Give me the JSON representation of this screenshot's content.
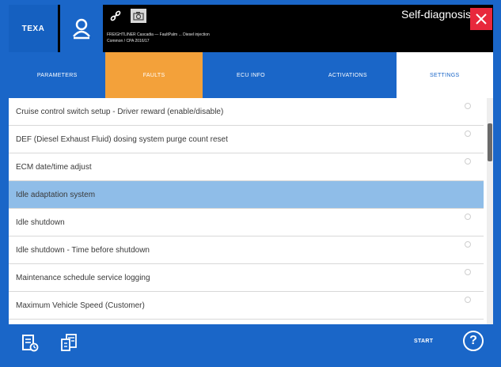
{
  "header": {
    "logo_text": "TEXA",
    "vehicle_line1": "FREIGHTLINER Cascadia — FaultPalm ... Diesel injection",
    "vehicle_line2": "Common / CPA 2016/17",
    "title": "Self-diagnosis",
    "close_icon": "close-icon",
    "brand_color": "#1a66c8",
    "close_color": "#e8283c"
  },
  "tabs": [
    {
      "label": "PARAMETERS"
    },
    {
      "label": "FAULTS"
    },
    {
      "label": "ECU INFO"
    },
    {
      "label": "ACTIVATIONS"
    },
    {
      "label": "SETTINGS"
    }
  ],
  "active_tab_color": "#f3a13a",
  "list": {
    "items": [
      {
        "label": "Cruise control switch setup - Driver reward (enable/disable)"
      },
      {
        "label": "DEF (Diesel Exhaust Fluid) dosing system purge count reset"
      },
      {
        "label": "ECM date/time adjust"
      },
      {
        "label": "Idle adaptation system",
        "selected": true
      },
      {
        "label": "Idle shutdown"
      },
      {
        "label": "Idle shutdown - Time before shutdown"
      },
      {
        "label": "Maintenance schedule service logging"
      },
      {
        "label": "Maximum Vehicle Speed (Customer)"
      }
    ],
    "selected_color": "#8fbde8"
  },
  "bottom": {
    "start_label": "START",
    "help_label": "?"
  }
}
